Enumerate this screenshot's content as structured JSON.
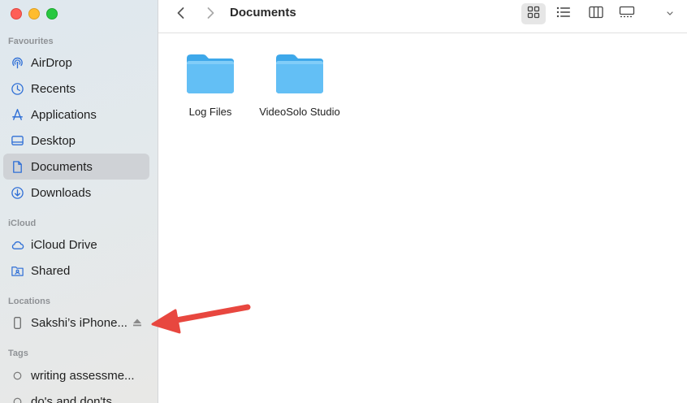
{
  "window": {
    "title": "Documents"
  },
  "sidebar": {
    "favourites_title": "Favourites",
    "favourites": [
      {
        "label": "AirDrop",
        "icon": "airdrop-icon"
      },
      {
        "label": "Recents",
        "icon": "clock-icon"
      },
      {
        "label": "Applications",
        "icon": "applications-icon"
      },
      {
        "label": "Desktop",
        "icon": "desktop-icon"
      },
      {
        "label": "Documents",
        "icon": "document-icon",
        "selected": true
      },
      {
        "label": "Downloads",
        "icon": "download-icon"
      }
    ],
    "icloud_title": "iCloud",
    "icloud": [
      {
        "label": "iCloud Drive",
        "icon": "cloud-icon"
      },
      {
        "label": "Shared",
        "icon": "shared-folder-icon"
      }
    ],
    "locations_title": "Locations",
    "locations": [
      {
        "label": "Sakshi’s iPhone...",
        "icon": "iphone-icon",
        "eject_icon": "eject-icon"
      }
    ],
    "tags_title": "Tags",
    "tags": [
      {
        "label": "writing assessme...",
        "icon": "tag-circle-icon"
      },
      {
        "label": "do's and don'ts",
        "icon": "tag-circle-icon"
      }
    ]
  },
  "toolbar": {
    "back_icon": "chevron-left-icon",
    "forward_icon": "chevron-right-icon",
    "view_icons": [
      "grid-view-icon",
      "list-view-icon",
      "column-view-icon",
      "gallery-view-icon"
    ],
    "selected_view": "grid-view-icon"
  },
  "files": [
    {
      "name": "Log Files",
      "icon": "folder-icon"
    },
    {
      "name": "VideoSolo Studio",
      "icon": "folder-icon"
    }
  ],
  "annotation": {
    "arrow_color": "#e8473f",
    "target": "Sakshi’s iPhone..."
  },
  "colors": {
    "accent": "#2f6fd6",
    "folder": "#5bbcf4",
    "selected_row": "#cfd2d6"
  }
}
